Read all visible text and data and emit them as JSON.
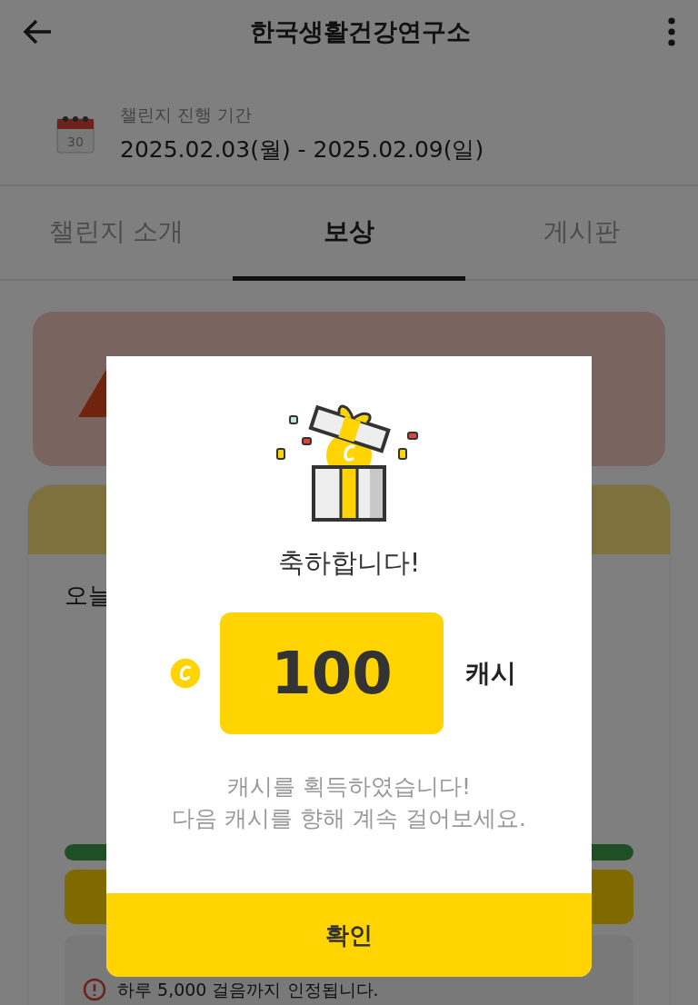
{
  "header": {
    "title": "한국생활건강연구소"
  },
  "period": {
    "label": "챌린지 진행 기간",
    "dates": "2025.02.03(월) - 2025.02.09(일)",
    "day": "30"
  },
  "tabs": [
    {
      "label": "챌린지 소개",
      "selected": false
    },
    {
      "label": "보상",
      "selected": true
    },
    {
      "label": "게시판",
      "selected": false
    }
  ],
  "background": {
    "today_label": "오늘",
    "progress": {
      "level": 1
    },
    "notice": "하루 5,000 걸음까지 인정됩니다."
  },
  "dialog": {
    "title": "축하합니다!",
    "amount": "100",
    "unit": "캐시",
    "message_lines": [
      "캐시를 획득하였습니다!",
      "다음 캐시를 향해 계속 걸어보세요."
    ],
    "confirm": "확인"
  }
}
